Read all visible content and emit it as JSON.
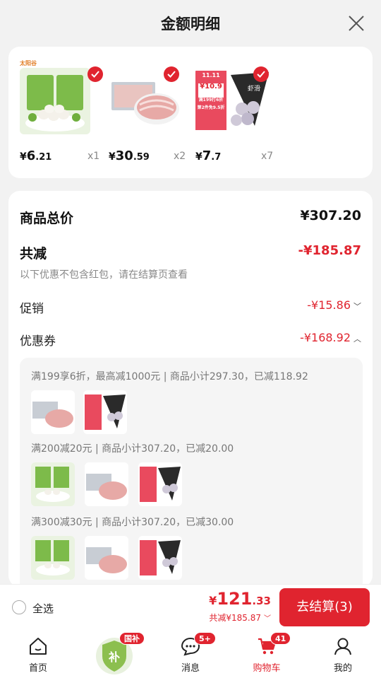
{
  "header": {
    "title": "金额明细"
  },
  "products": [
    {
      "price_symbol": "¥",
      "price_int": "6",
      "price_dec": ".21",
      "qty": "x1",
      "brand_text": "太阳谷"
    },
    {
      "price_symbol": "¥",
      "price_int": "30",
      "price_dec": ".59",
      "qty": "x2"
    },
    {
      "price_symbol": "¥",
      "price_int": "7",
      "price_dec": ".7",
      "qty": "x7",
      "tag_text": "11.11",
      "tag_price": "¥10.9",
      "tag_line1": "满199打6折",
      "tag_line2": "第2件免9.5折",
      "pack_text": "虾滑"
    }
  ],
  "summary": {
    "total_label": "商品总价",
    "total_value": "¥307.20",
    "reduce_label": "共减",
    "reduce_value": "-¥185.87",
    "note": "以下优惠不包含红包，请在结算页查看",
    "promo_label": "促销",
    "promo_value": "-¥15.86",
    "coupon_label": "优惠券",
    "coupon_value": "-¥168.92"
  },
  "coupons": [
    {
      "title": "满199享6折，最高减1000元 | 商品小计297.30，已减118.92"
    },
    {
      "title": "满200减20元 | 商品小计307.20，已减20.00"
    },
    {
      "title": "满300减30元 | 商品小计307.20，已减30.00"
    }
  ],
  "footer": {
    "select_all": "全选",
    "total_symbol": "¥",
    "total_int": "121",
    "total_dec": ".33",
    "saved": "共减¥185.87",
    "checkout": "去结算(3)"
  },
  "tabs": [
    {
      "label": "首页"
    },
    {
      "label": "",
      "badge": "国补",
      "center_char": "补"
    },
    {
      "label": "消息",
      "badge": "5+"
    },
    {
      "label": "购物车",
      "badge": "41"
    },
    {
      "label": "我的"
    }
  ],
  "colors": {
    "accent": "#e0242f",
    "text": "#222222",
    "muted": "#888888"
  }
}
